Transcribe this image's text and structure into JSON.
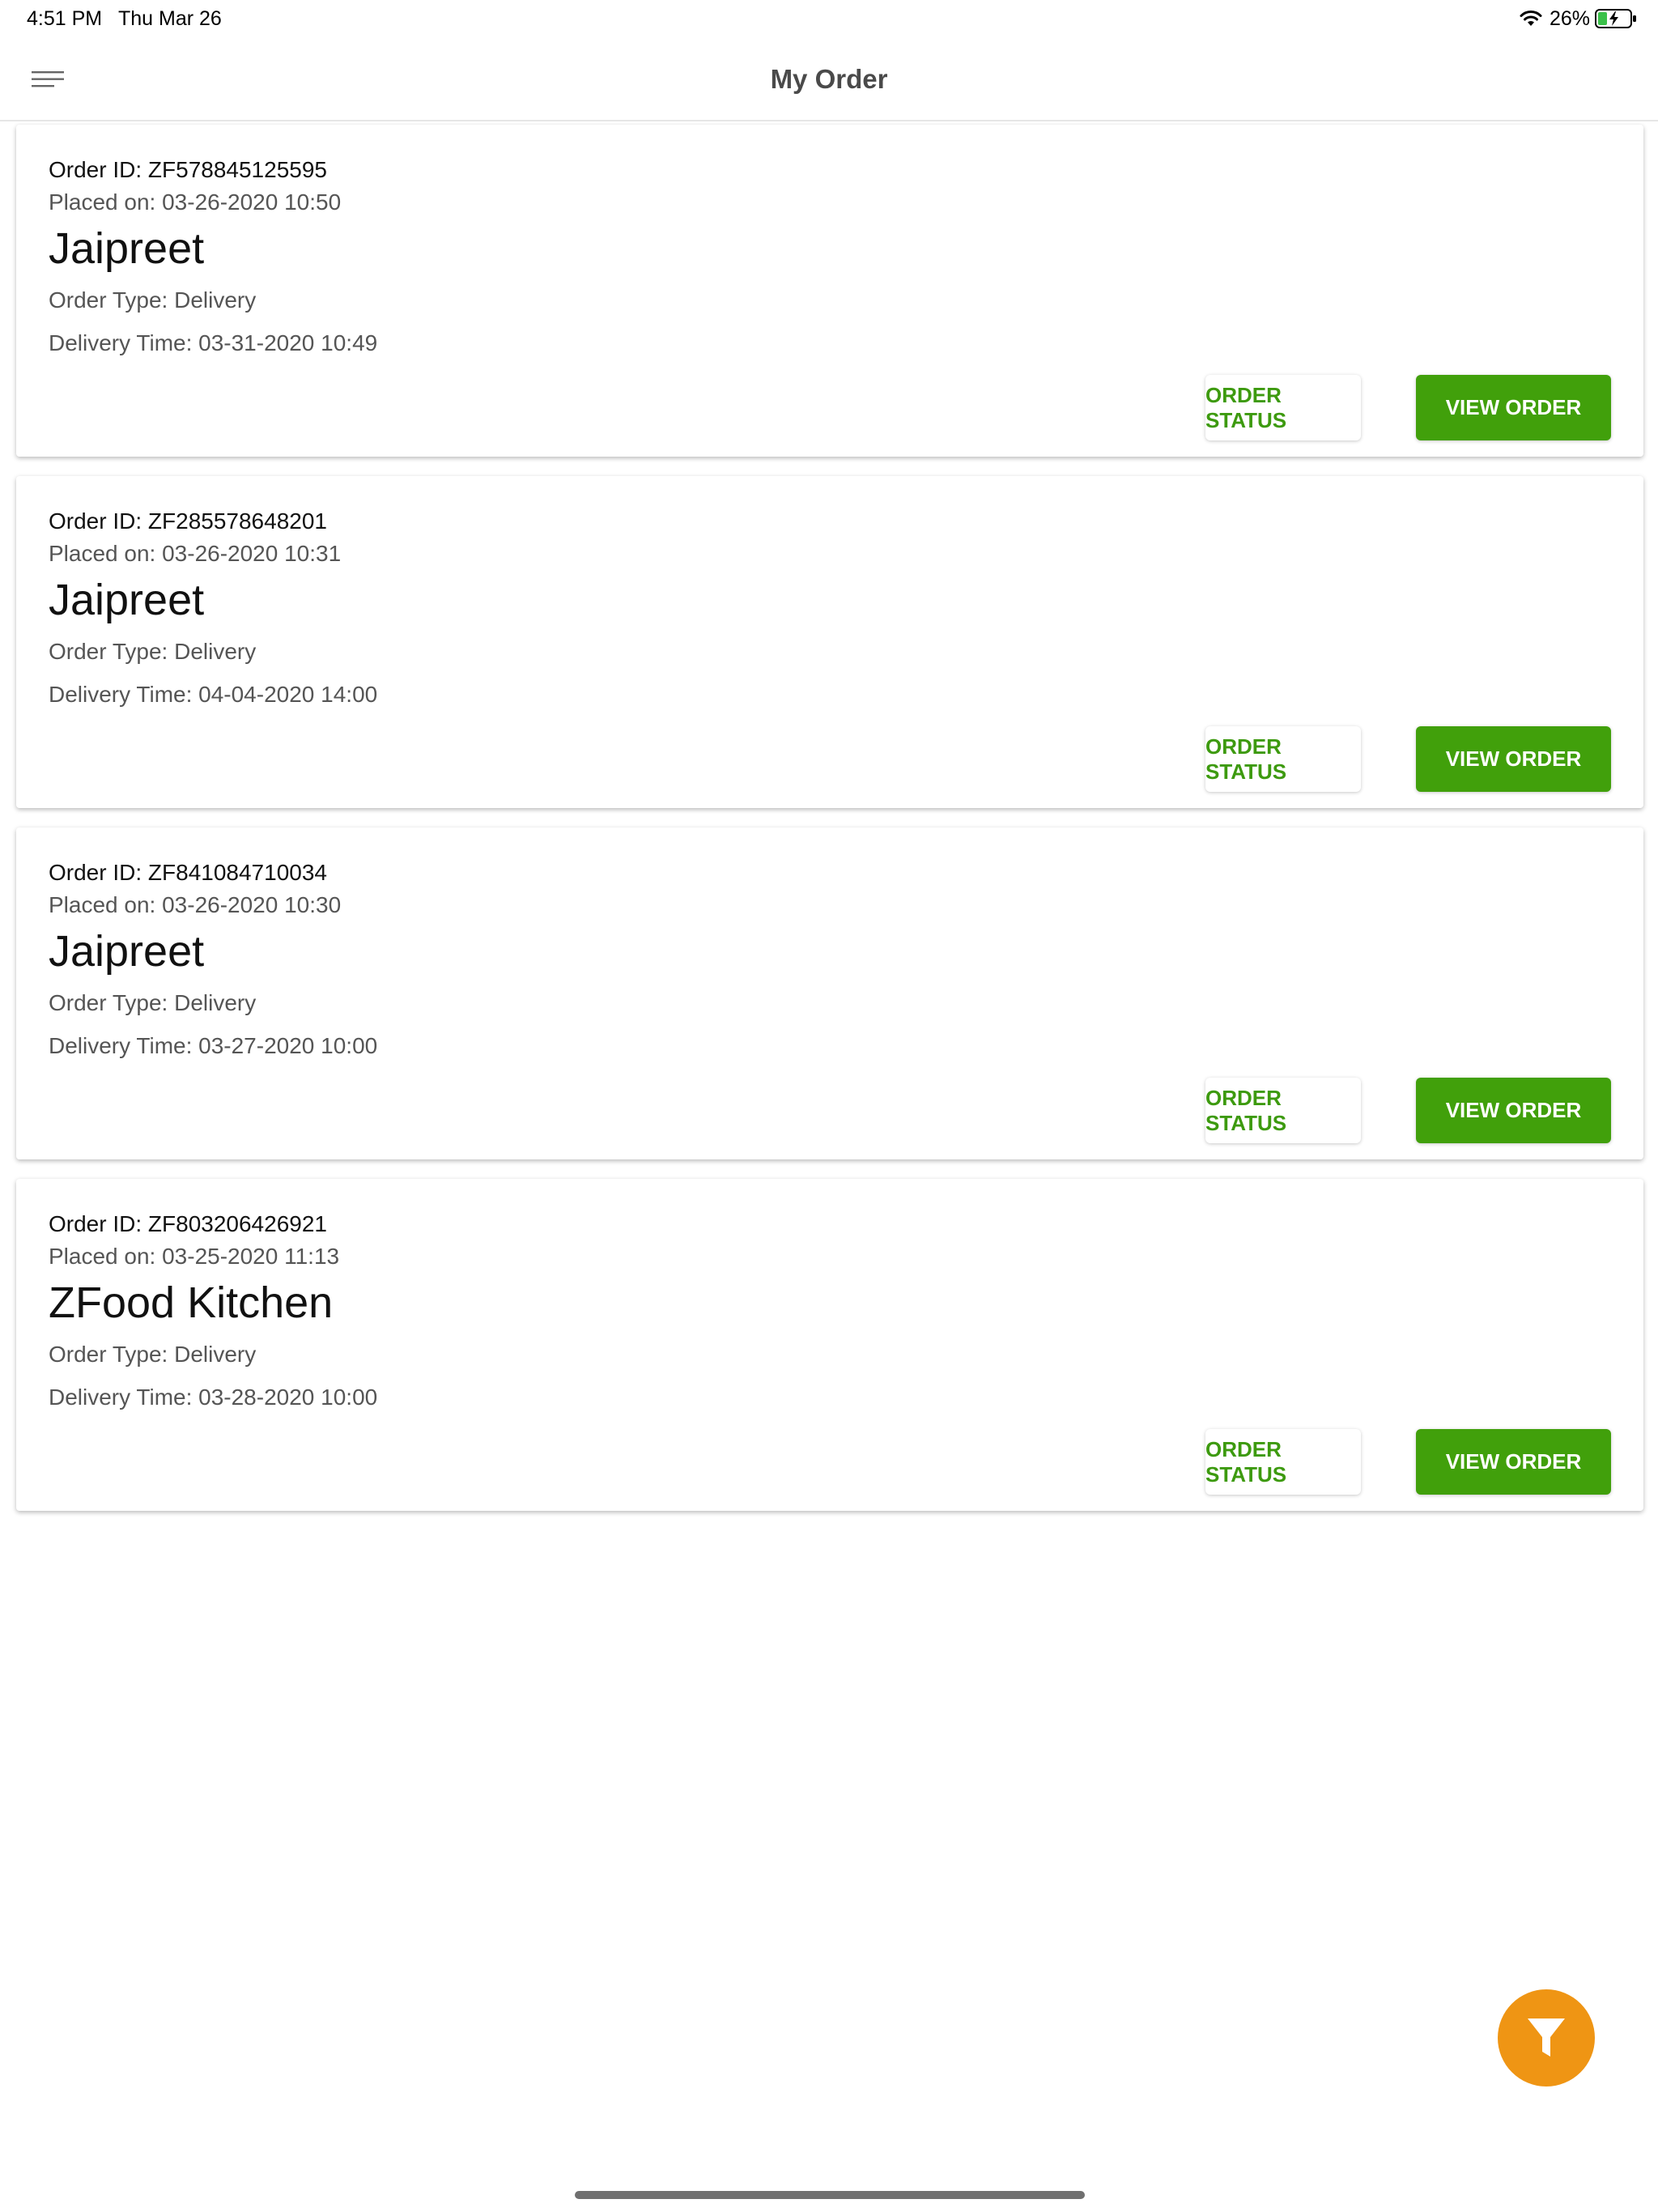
{
  "status_bar": {
    "time": "4:51 PM",
    "date": "Thu Mar 26",
    "battery_percent": "26%",
    "battery_level": 0.26,
    "charging": true,
    "icons": [
      "wifi-icon",
      "battery-icon"
    ]
  },
  "app_bar": {
    "title": "My Order",
    "menu_icon": "hamburger-menu-icon"
  },
  "orders": [
    {
      "order_id": "Order ID: ZF578845125595",
      "placed_on": "Placed on: 03-26-2020 10:50",
      "restaurant": "Jaipreet",
      "order_type": "Order Type: Delivery",
      "delivery_time": "Delivery Time: 03-31-2020 10:49",
      "status_button": "ORDER STATUS",
      "view_button": "VIEW ORDER"
    },
    {
      "order_id": "Order ID: ZF285578648201",
      "placed_on": "Placed on: 03-26-2020 10:31",
      "restaurant": "Jaipreet",
      "order_type": "Order Type: Delivery",
      "delivery_time": "Delivery Time: 04-04-2020 14:00",
      "status_button": "ORDER STATUS",
      "view_button": "VIEW ORDER"
    },
    {
      "order_id": "Order ID: ZF841084710034",
      "placed_on": "Placed on: 03-26-2020 10:30",
      "restaurant": "Jaipreet",
      "order_type": "Order Type: Delivery",
      "delivery_time": "Delivery Time: 03-27-2020 10:00",
      "status_button": "ORDER STATUS",
      "view_button": "VIEW ORDER"
    },
    {
      "order_id": "Order ID: ZF803206426921",
      "placed_on": "Placed on: 03-25-2020 11:13",
      "restaurant": "ZFood Kitchen",
      "order_type": "Order Type: Delivery",
      "delivery_time": "Delivery Time: 03-28-2020 10:00",
      "status_button": "ORDER STATUS",
      "view_button": "VIEW ORDER"
    }
  ],
  "fab": {
    "icon": "filter-icon"
  },
  "colors": {
    "primary_green": "#41a00b",
    "status_text_green": "#3d9a0f",
    "fab_orange": "#ef9514",
    "title_gray": "#4a4a4a",
    "secondary_text": "#555555"
  }
}
